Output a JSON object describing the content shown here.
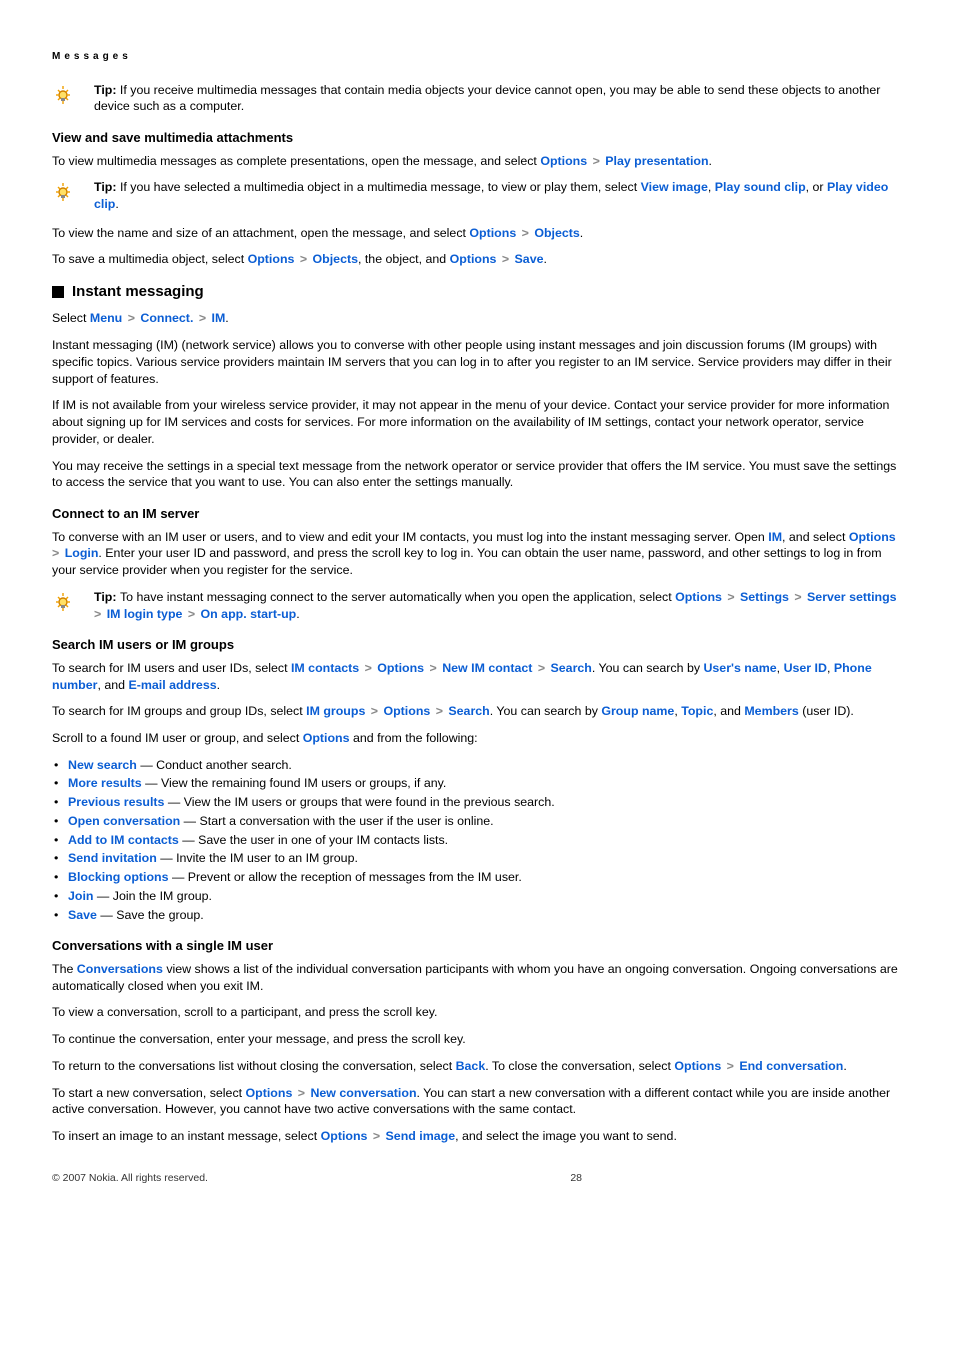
{
  "header": "Messages",
  "tip_mms": {
    "lead": "Tip:",
    "body": " If you receive multimedia messages that contain media objects your device cannot open, you may be able to send these objects to another device such as a computer."
  },
  "attach": {
    "title": "View and save multimedia attachments",
    "p1a": "To view multimedia messages as complete presentations, open the message, and select ",
    "options": "Options",
    "play_pres": "Play presentation",
    "dot": ".",
    "tip_lead": "Tip: ",
    "tip_body1": "If you have selected a multimedia object in a multimedia message, to view or play them, select ",
    "view_image": "View image",
    "sep": ", ",
    "play_sound": "Play sound clip",
    "or": ", or ",
    "play_video": "Play video clip",
    "p2a": "To view the name and size of an attachment, open the message, and select ",
    "objects": "Objects",
    "p3a": "To save a multimedia object, select ",
    "p3b": ", the object, and ",
    "save": "Save"
  },
  "im": {
    "title": "Instant messaging",
    "sel": "Select ",
    "menu": "Menu",
    "connect": "Connect.",
    "im_lbl": "IM",
    "dot": ".",
    "p1": "Instant messaging (IM) (network service) allows you to converse with other people using instant messages and join discussion forums (IM groups) with specific topics. Various service providers maintain IM servers that you can log in to after you register to an IM service. Service providers may differ in their support of features.",
    "p2": "If IM is not available from your wireless service provider, it may not appear in the menu of your device. Contact your service provider for more information about signing up for IM services and costs for services. For more information on the availability of IM settings, contact your network operator, service provider, or dealer.",
    "p3": "You may receive the settings in a special text message from the network operator or service provider that offers the IM service. You must save the settings to access the service that you want to use. You can also enter the settings manually."
  },
  "connect": {
    "title": "Connect to an IM server",
    "p1a": "To converse with an IM user or users, and to view and edit your IM contacts, you must log into the instant messaging server. Open ",
    "im": "IM",
    "and_sel": ", and select ",
    "options": "Options",
    "login": "Login",
    "p1b": ". Enter your user ID and password, and press the scroll key to log in. You can obtain the user name, password, and other settings to log in from your service provider when you register for the service.",
    "tip_lead": "Tip:  ",
    "tip_body": "To have instant messaging connect to the server automatically when you open the application, select ",
    "settings": "Settings",
    "server_settings": "Server settings",
    "login_type": "IM login type",
    "startup": "On app. start-up",
    "dot": "."
  },
  "search": {
    "title": "Search IM users or IM groups",
    "p1a": "To search for IM users and user IDs, select ",
    "im_contacts": "IM contacts",
    "options": "Options",
    "new_im": "New IM contact",
    "search_lbl": "Search",
    "p1b": ". You can search by ",
    "uname": "User's name",
    "sep": ", ",
    "uid": "User ID",
    "phone": "Phone number",
    "and": ", and ",
    "email": "E-mail address",
    "dot": ".",
    "p2a": "To search for IM groups and group IDs, select ",
    "im_groups": "IM groups",
    "p2b": ". You can search by ",
    "gname": "Group name",
    "topic": "Topic",
    "members": "Members",
    "uid_paren": " (user ID).",
    "p3a": "Scroll to a found IM user or group, and select ",
    "p3b": " and from the following:",
    "items": {
      "a": {
        "l": "New search",
        "t": " — Conduct another search."
      },
      "b": {
        "l": "More results",
        "t": " — View the remaining found IM users or groups, if any."
      },
      "c": {
        "l": "Previous results",
        "t": " — View the IM users or groups that were found in the previous search."
      },
      "d": {
        "l": "Open conversation",
        "t": " — Start a conversation with the user if the user is online."
      },
      "e": {
        "l": "Add to IM contacts",
        "t": " — Save the user in one of your IM contacts lists."
      },
      "f": {
        "l": "Send invitation",
        "t": " — Invite the IM user to an IM group."
      },
      "g": {
        "l": "Blocking options",
        "t": " — Prevent or allow the reception of messages from the IM user."
      },
      "h": {
        "l": "Join",
        "t": " — Join the IM group."
      },
      "i": {
        "l": "Save",
        "t": " — Save the group."
      }
    }
  },
  "conv": {
    "title": "Conversations with a single IM user",
    "p1a": "The ",
    "conversations": "Conversations",
    "p1b": " view shows a list of the individual conversation participants with whom you have an ongoing conversation. Ongoing conversations are automatically closed when you exit IM.",
    "p2": "To view a conversation, scroll to a participant, and press the scroll key.",
    "p3": "To continue the conversation, enter your message, and press the scroll key.",
    "p4a": "To return to the conversations list without closing the conversation, select ",
    "back": "Back",
    "p4b": ". To close the conversation, select ",
    "options": "Options",
    "end_conv": "End conversation",
    "dot": ".",
    "p5a": "To start a new conversation, select ",
    "new_conv": "New conversation",
    "p5b": ". You can start a new conversation with a different contact while you are inside another active conversation. However, you cannot have two active conversations with the same contact.",
    "p6a": "To insert an image to an instant message, select ",
    "send_image": "Send image",
    "p6b": ", and select the image you want to send."
  },
  "footer": {
    "copy": "© 2007 Nokia. All rights reserved.",
    "page": "28"
  }
}
